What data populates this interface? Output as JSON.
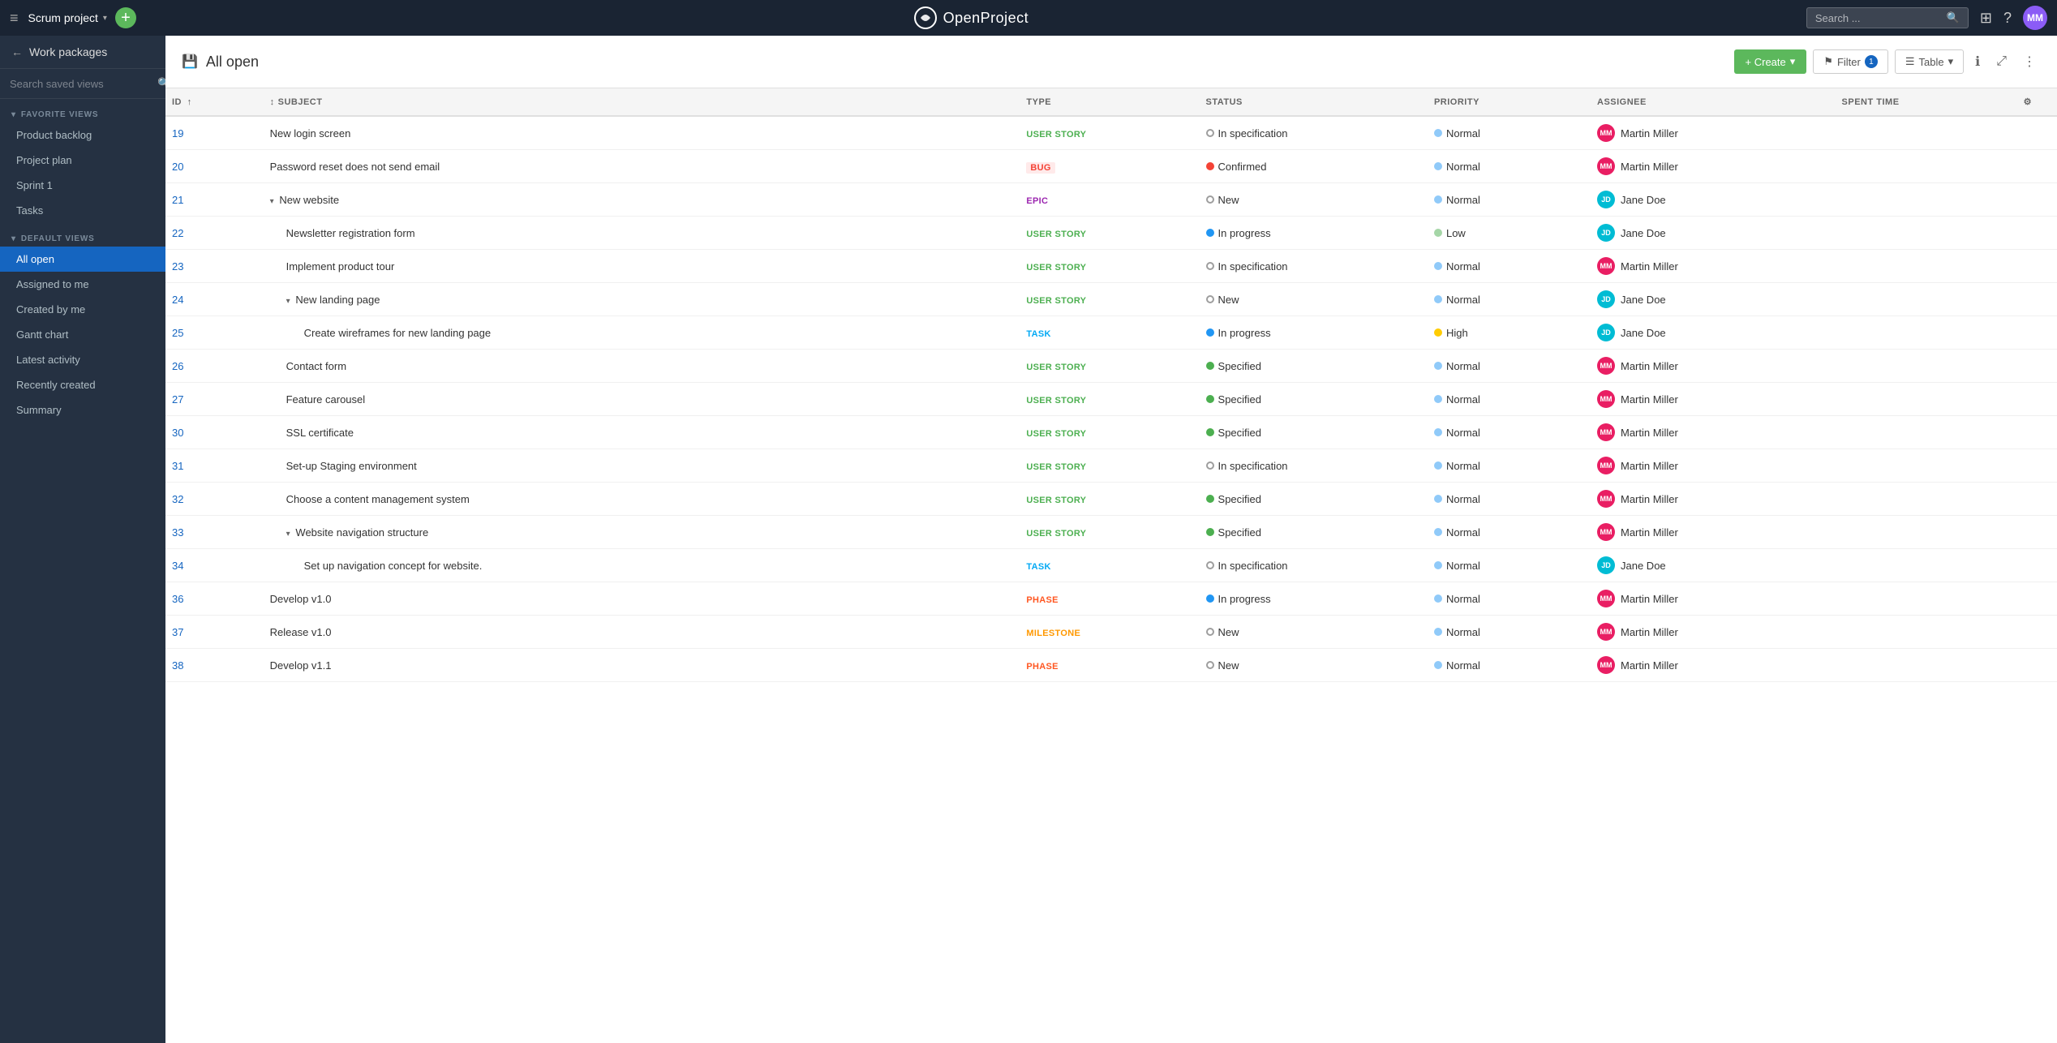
{
  "topNav": {
    "hamburger": "≡",
    "projectName": "Scrum project",
    "projectCaret": "▾",
    "addBtnLabel": "+",
    "logoAlt": "OpenProject",
    "searchPlaceholder": "Search ...",
    "gridIcon": "⊞",
    "helpIcon": "?",
    "avatarInitials": "MM"
  },
  "sidebar": {
    "backLabel": "Work packages",
    "searchPlaceholder": "Search saved views",
    "favoriteGroupLabel": "FAVORITE VIEWS",
    "favoriteItems": [
      {
        "id": "product-backlog",
        "label": "Product backlog"
      },
      {
        "id": "project-plan",
        "label": "Project plan"
      },
      {
        "id": "sprint-1",
        "label": "Sprint 1"
      },
      {
        "id": "tasks",
        "label": "Tasks"
      }
    ],
    "defaultGroupLabel": "DEFAULT VIEWS",
    "defaultItems": [
      {
        "id": "all-open",
        "label": "All open",
        "active": true
      },
      {
        "id": "assigned-to-me",
        "label": "Assigned to me"
      },
      {
        "id": "created-by-me",
        "label": "Created by me"
      },
      {
        "id": "gantt-chart",
        "label": "Gantt chart"
      },
      {
        "id": "latest-activity",
        "label": "Latest activity"
      },
      {
        "id": "recently-created",
        "label": "Recently created"
      },
      {
        "id": "summary",
        "label": "Summary"
      }
    ]
  },
  "header": {
    "titleIcon": "💾",
    "pageTitle": "All open",
    "createLabel": "+ Create",
    "filterLabel": "Filter",
    "filterCount": "1",
    "tableLabel": "Table",
    "infoIcon": "ℹ",
    "expandIcon": "⤢",
    "moreIcon": "⋮"
  },
  "table": {
    "columns": [
      {
        "id": "id",
        "label": "ID",
        "sortable": true
      },
      {
        "id": "subject",
        "label": "SUBJECT",
        "sortable": true
      },
      {
        "id": "type",
        "label": "TYPE"
      },
      {
        "id": "status",
        "label": "STATUS"
      },
      {
        "id": "priority",
        "label": "PRIORITY"
      },
      {
        "id": "assignee",
        "label": "ASSIGNEE"
      },
      {
        "id": "spent",
        "label": "SPENT TIME"
      },
      {
        "id": "settings",
        "label": "⚙"
      }
    ],
    "rows": [
      {
        "id": 19,
        "indent": 0,
        "collapse": false,
        "subject": "New login screen",
        "type": "USER STORY",
        "typeClass": "type-user-story",
        "status": "In specification",
        "statusColor": "#9e9e9e",
        "statusFilled": false,
        "priority": "Normal",
        "priorityClass": "priority-normal",
        "assignee": "Martin Miller",
        "assigneeInitials": "MM",
        "avatarClass": "avatar-mm"
      },
      {
        "id": 20,
        "indent": 0,
        "collapse": false,
        "subject": "Password reset does not send email",
        "type": "BUG",
        "typeClass": "type-bug",
        "status": "Confirmed",
        "statusColor": "#f44336",
        "statusFilled": true,
        "priority": "Normal",
        "priorityClass": "priority-normal",
        "assignee": "Martin Miller",
        "assigneeInitials": "MM",
        "avatarClass": "avatar-mm"
      },
      {
        "id": 21,
        "indent": 0,
        "collapse": true,
        "subject": "New website",
        "type": "EPIC",
        "typeClass": "type-epic",
        "status": "New",
        "statusColor": "#9e9e9e",
        "statusFilled": false,
        "priority": "Normal",
        "priorityClass": "priority-normal",
        "assignee": "Jane Doe",
        "assigneeInitials": "JD",
        "avatarClass": "avatar-jd"
      },
      {
        "id": 22,
        "indent": 1,
        "collapse": false,
        "subject": "Newsletter registration form",
        "type": "USER STORY",
        "typeClass": "type-user-story",
        "status": "In progress",
        "statusColor": "#2196f3",
        "statusFilled": true,
        "priority": "Low",
        "priorityClass": "priority-low",
        "assignee": "Jane Doe",
        "assigneeInitials": "JD",
        "avatarClass": "avatar-jd"
      },
      {
        "id": 23,
        "indent": 1,
        "collapse": false,
        "subject": "Implement product tour",
        "type": "USER STORY",
        "typeClass": "type-user-story",
        "status": "In specification",
        "statusColor": "#9e9e9e",
        "statusFilled": false,
        "priority": "Normal",
        "priorityClass": "priority-normal",
        "assignee": "Martin Miller",
        "assigneeInitials": "MM",
        "avatarClass": "avatar-mm"
      },
      {
        "id": 24,
        "indent": 1,
        "collapse": true,
        "subject": "New landing page",
        "type": "USER STORY",
        "typeClass": "type-user-story",
        "status": "New",
        "statusColor": "#9e9e9e",
        "statusFilled": false,
        "priority": "Normal",
        "priorityClass": "priority-normal",
        "assignee": "Jane Doe",
        "assigneeInitials": "JD",
        "avatarClass": "avatar-jd"
      },
      {
        "id": 25,
        "indent": 2,
        "collapse": false,
        "subject": "Create wireframes for new landing page",
        "type": "TASK",
        "typeClass": "type-task",
        "status": "In progress",
        "statusColor": "#2196f3",
        "statusFilled": true,
        "priority": "High",
        "priorityClass": "priority-high",
        "assignee": "Jane Doe",
        "assigneeInitials": "JD",
        "avatarClass": "avatar-jd"
      },
      {
        "id": 26,
        "indent": 1,
        "collapse": false,
        "subject": "Contact form",
        "type": "USER STORY",
        "typeClass": "type-user-story",
        "status": "Specified",
        "statusColor": "#4caf50",
        "statusFilled": true,
        "priority": "Normal",
        "priorityClass": "priority-normal",
        "assignee": "Martin Miller",
        "assigneeInitials": "MM",
        "avatarClass": "avatar-mm"
      },
      {
        "id": 27,
        "indent": 1,
        "collapse": false,
        "subject": "Feature carousel",
        "type": "USER STORY",
        "typeClass": "type-user-story",
        "status": "Specified",
        "statusColor": "#4caf50",
        "statusFilled": true,
        "priority": "Normal",
        "priorityClass": "priority-normal",
        "assignee": "Martin Miller",
        "assigneeInitials": "MM",
        "avatarClass": "avatar-mm"
      },
      {
        "id": 30,
        "indent": 1,
        "collapse": false,
        "subject": "SSL certificate",
        "type": "USER STORY",
        "typeClass": "type-user-story",
        "status": "Specified",
        "statusColor": "#4caf50",
        "statusFilled": true,
        "priority": "Normal",
        "priorityClass": "priority-normal",
        "assignee": "Martin Miller",
        "assigneeInitials": "MM",
        "avatarClass": "avatar-mm"
      },
      {
        "id": 31,
        "indent": 1,
        "collapse": false,
        "subject": "Set-up Staging environment",
        "type": "USER STORY",
        "typeClass": "type-user-story",
        "status": "In specification",
        "statusColor": "#9e9e9e",
        "statusFilled": false,
        "priority": "Normal",
        "priorityClass": "priority-normal",
        "assignee": "Martin Miller",
        "assigneeInitials": "MM",
        "avatarClass": "avatar-mm"
      },
      {
        "id": 32,
        "indent": 1,
        "collapse": false,
        "subject": "Choose a content management system",
        "type": "USER STORY",
        "typeClass": "type-user-story",
        "status": "Specified",
        "statusColor": "#4caf50",
        "statusFilled": true,
        "priority": "Normal",
        "priorityClass": "priority-normal",
        "assignee": "Martin Miller",
        "assigneeInitials": "MM",
        "avatarClass": "avatar-mm"
      },
      {
        "id": 33,
        "indent": 1,
        "collapse": true,
        "subject": "Website navigation structure",
        "type": "USER STORY",
        "typeClass": "type-user-story",
        "status": "Specified",
        "statusColor": "#4caf50",
        "statusFilled": true,
        "priority": "Normal",
        "priorityClass": "priority-normal",
        "assignee": "Martin Miller",
        "assigneeInitials": "MM",
        "avatarClass": "avatar-mm"
      },
      {
        "id": 34,
        "indent": 2,
        "collapse": false,
        "subject": "Set up navigation concept for website.",
        "type": "TASK",
        "typeClass": "type-task",
        "status": "In specification",
        "statusColor": "#9e9e9e",
        "statusFilled": false,
        "priority": "Normal",
        "priorityClass": "priority-normal",
        "assignee": "Jane Doe",
        "assigneeInitials": "JD",
        "avatarClass": "avatar-jd"
      },
      {
        "id": 36,
        "indent": 0,
        "collapse": false,
        "subject": "Develop v1.0",
        "type": "PHASE",
        "typeClass": "type-phase",
        "status": "In progress",
        "statusColor": "#2196f3",
        "statusFilled": true,
        "priority": "Normal",
        "priorityClass": "priority-normal",
        "assignee": "Martin Miller",
        "assigneeInitials": "MM",
        "avatarClass": "avatar-mm"
      },
      {
        "id": 37,
        "indent": 0,
        "collapse": false,
        "subject": "Release v1.0",
        "type": "MILESTONE",
        "typeClass": "type-milestone",
        "status": "New",
        "statusColor": "#9e9e9e",
        "statusFilled": false,
        "priority": "Normal",
        "priorityClass": "priority-normal",
        "assignee": "Martin Miller",
        "assigneeInitials": "MM",
        "avatarClass": "avatar-mm"
      },
      {
        "id": 38,
        "indent": 0,
        "collapse": false,
        "subject": "Develop v1.1",
        "type": "PHASE",
        "typeClass": "type-phase",
        "status": "New",
        "statusColor": "#9e9e9e",
        "statusFilled": false,
        "priority": "Normal",
        "priorityClass": "priority-normal",
        "assignee": "Martin Miller",
        "assigneeInitials": "MM",
        "avatarClass": "avatar-mm"
      }
    ]
  }
}
